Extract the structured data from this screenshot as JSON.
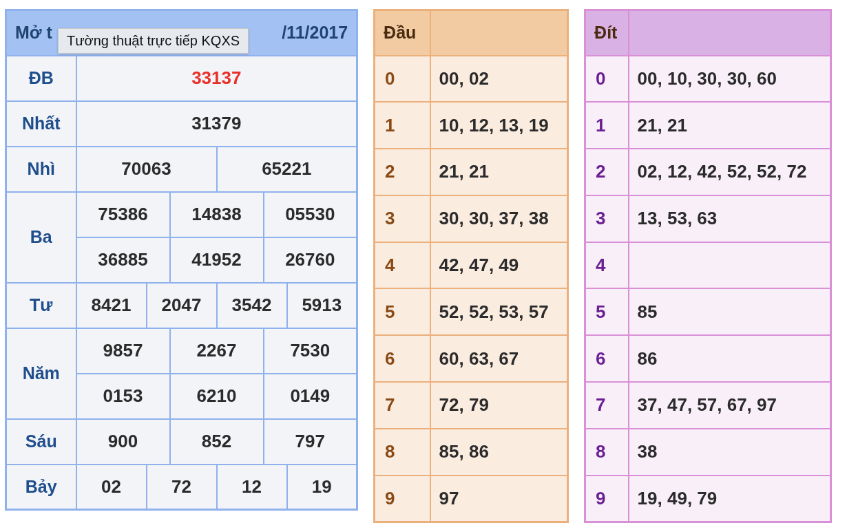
{
  "results": {
    "title_start": "Mở t",
    "title_end": "/11/2017",
    "tooltip": "Tường thuật trực tiếp KQXS",
    "prizes": [
      {
        "name": "ĐB",
        "highlight": true,
        "rows": [
          [
            "33137"
          ]
        ]
      },
      {
        "name": "Nhất",
        "highlight": false,
        "rows": [
          [
            "31379"
          ]
        ]
      },
      {
        "name": "Nhì",
        "highlight": false,
        "rows": [
          [
            "70063",
            "65221"
          ]
        ]
      },
      {
        "name": "Ba",
        "highlight": false,
        "rows": [
          [
            "75386",
            "14838",
            "05530"
          ],
          [
            "36885",
            "41952",
            "26760"
          ]
        ]
      },
      {
        "name": "Tư",
        "highlight": false,
        "rows": [
          [
            "8421",
            "2047",
            "3542",
            "5913"
          ]
        ]
      },
      {
        "name": "Năm",
        "highlight": false,
        "rows": [
          [
            "9857",
            "2267",
            "7530"
          ],
          [
            "0153",
            "6210",
            "0149"
          ]
        ]
      },
      {
        "name": "Sáu",
        "highlight": false,
        "rows": [
          [
            "900",
            "852",
            "797"
          ]
        ]
      },
      {
        "name": "Bảy",
        "highlight": false,
        "rows": [
          [
            "02",
            "72",
            "12",
            "19"
          ]
        ]
      }
    ]
  },
  "tables": [
    {
      "kind": "head",
      "heading": "Đầu",
      "rows": [
        {
          "digit": "0",
          "numbers": "00, 02"
        },
        {
          "digit": "1",
          "numbers": "10, 12, 13, 19"
        },
        {
          "digit": "2",
          "numbers": "21, 21"
        },
        {
          "digit": "3",
          "numbers": "30, 30, 37, 38"
        },
        {
          "digit": "4",
          "numbers": "42, 47, 49"
        },
        {
          "digit": "5",
          "numbers": "52, 52, 53, 57"
        },
        {
          "digit": "6",
          "numbers": "60, 63, 67"
        },
        {
          "digit": "7",
          "numbers": "72, 79"
        },
        {
          "digit": "8",
          "numbers": "85, 86"
        },
        {
          "digit": "9",
          "numbers": "97"
        }
      ]
    },
    {
      "kind": "tail",
      "heading": "Đít",
      "rows": [
        {
          "digit": "0",
          "numbers": "00, 10, 30, 30, 60"
        },
        {
          "digit": "1",
          "numbers": "21, 21"
        },
        {
          "digit": "2",
          "numbers": "02, 12, 42, 52, 52, 72"
        },
        {
          "digit": "3",
          "numbers": "13, 53, 63"
        },
        {
          "digit": "4"
        },
        {
          "digit": "5",
          "numbers": "85"
        },
        {
          "digit": "6",
          "numbers": "86"
        },
        {
          "digit": "7",
          "numbers": "37, 47, 57, 67, 97"
        },
        {
          "digit": "8",
          "numbers": "38"
        },
        {
          "digit": "9",
          "numbers": "19, 49, 79"
        }
      ]
    }
  ]
}
